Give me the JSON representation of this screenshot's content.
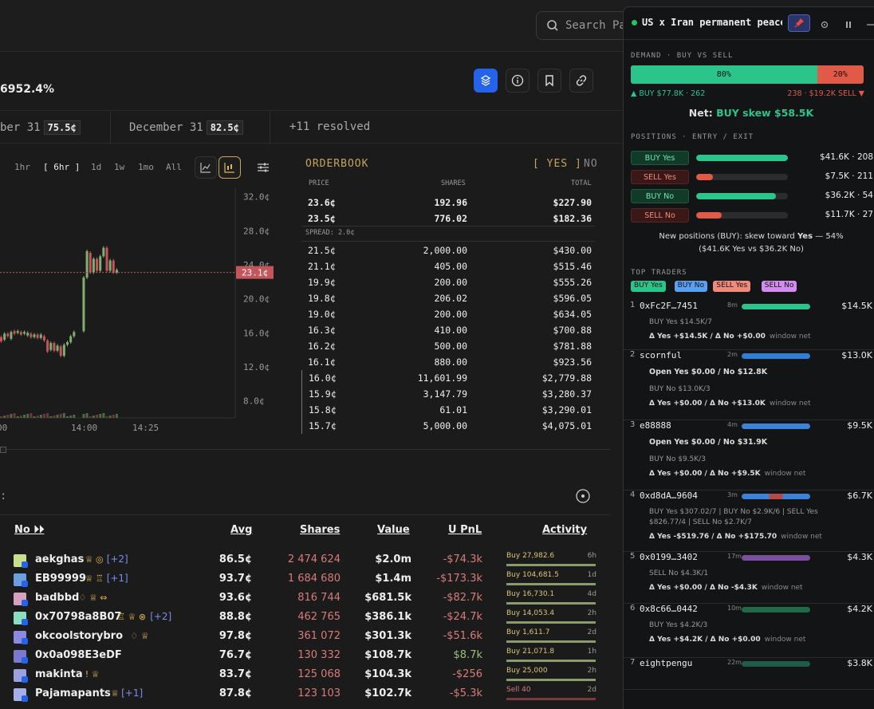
{
  "search": {
    "placeholder": "Search Pa"
  },
  "market": {
    "percent_change": "6952.4%"
  },
  "dates": [
    {
      "label": "ber 31",
      "price": "75.5¢"
    },
    {
      "label": "December 31",
      "price": "82.5¢"
    },
    {
      "label": "+11 resolved",
      "price": ""
    }
  ],
  "timeframes": [
    "1hr",
    "[ 6hr ]",
    "1d",
    "1w",
    "1mo",
    "All"
  ],
  "chart": {
    "y_ticks": [
      "32.0¢",
      "28.0¢",
      "24.0¢",
      "20.0¢",
      "16.0¢",
      "12.0¢",
      "8.0¢"
    ],
    "x_ticks": [
      "00",
      "14:00",
      "14:25"
    ],
    "current_price": "23.1¢"
  },
  "chart_data": {
    "type": "bar",
    "title": "",
    "xlabel": "",
    "ylabel": "",
    "ylim": [
      6,
      33
    ],
    "categories": [
      "00",
      "14:00",
      "14:25"
    ],
    "series": [
      {
        "name": "",
        "values": [
          15.5,
          15.2,
          23.1
        ]
      }
    ],
    "current": 23.1
  },
  "orderbook": {
    "title": "ORDERBOOK",
    "yes_label": "[ YES ]",
    "no_label": "NO",
    "cols": [
      "PRICE",
      "SHARES",
      "TOTAL"
    ],
    "spread": "SPREAD: 2.0¢",
    "asks": [
      [
        "23.6¢",
        "192.96",
        "$227.90"
      ],
      [
        "23.5¢",
        "776.02",
        "$182.36"
      ]
    ],
    "bids": [
      [
        "21.5¢",
        "2,000.00",
        "$430.00"
      ],
      [
        "21.1¢",
        "405.00",
        "$515.46"
      ],
      [
        "19.9¢",
        "200.00",
        "$555.26"
      ],
      [
        "19.8¢",
        "206.02",
        "$596.05"
      ],
      [
        "19.0¢",
        "200.00",
        "$634.05"
      ],
      [
        "16.3¢",
        "410.00",
        "$700.88"
      ],
      [
        "16.2¢",
        "500.00",
        "$781.88"
      ],
      [
        "16.1¢",
        "880.00",
        "$923.56"
      ],
      [
        "16.0¢",
        "11,601.99",
        "$2,779.88"
      ],
      [
        "15.9¢",
        "3,147.79",
        "$3,280.37"
      ],
      [
        "15.8¢",
        "61.01",
        "$3,290.01"
      ],
      [
        "15.7¢",
        "5,000.00",
        "$4,075.01"
      ]
    ]
  },
  "holders": {
    "cols": {
      "name": "No ⏵⏵",
      "avg": "Avg",
      "shares": "Shares",
      "value": "Value",
      "upnl": "U PnL",
      "activity": "Activity"
    },
    "rows": [
      {
        "name": "aekghas",
        "badges": "♕ ◎",
        "extra": "[+2]",
        "avg": "86.5¢",
        "shares": "2 474 624",
        "value": "$2.0m",
        "upnl": "-$74.3k",
        "act": "Buy 27,982.6",
        "age": "6h",
        "pos": false
      },
      {
        "name": "EB99999",
        "badges": "♕ ♖",
        "extra": "[+1]",
        "avg": "93.7¢",
        "shares": "1 684 680",
        "value": "$1.4m",
        "upnl": "-$173.3k",
        "act": "Buy 104,681.5",
        "age": "1d",
        "pos": false
      },
      {
        "name": "badbbd",
        "badges": "♢ ♕ ⇔",
        "extra": "",
        "avg": "93.6¢",
        "shares": "816 744",
        "value": "$681.5k",
        "upnl": "-$82.7k",
        "act": "Buy 16,730.1",
        "age": "4d",
        "pos": false
      },
      {
        "name": "0x70798a8B07",
        "badges": "♖ ♕ ⊗",
        "extra": "[+2]",
        "avg": "88.8¢",
        "shares": "462 765",
        "value": "$386.1k",
        "upnl": "-$24.7k",
        "act": "Buy 14,053.4",
        "age": "2h",
        "pos": false
      },
      {
        "name": "okcoolstorybro",
        "badges": "♢ ♕",
        "extra": "",
        "avg": "97.8¢",
        "shares": "361 072",
        "value": "$301.3k",
        "upnl": "-$51.6k",
        "act": "Buy 1,611.7",
        "age": "2d",
        "pos": false
      },
      {
        "name": "0x0a098E3eDF",
        "badges": "",
        "extra": "",
        "avg": "76.7¢",
        "shares": "130 332",
        "value": "$108.7k",
        "upnl": "$8.7k",
        "act": "Buy 21,071.8",
        "age": "1h",
        "pos": true
      },
      {
        "name": "makinta",
        "badges": "! ♕",
        "extra": "",
        "avg": "83.7¢",
        "shares": "125 068",
        "value": "$104.3k",
        "upnl": "-$256",
        "act": "Buy 25,000",
        "age": "2h",
        "pos": false
      },
      {
        "name": "Pajamapants",
        "badges": "♕",
        "extra": "[+1]",
        "avg": "87.8¢",
        "shares": "123 103",
        "value": "$102.7k",
        "upnl": "-$5.3k",
        "act": "Sell 40",
        "age": "2d",
        "pos": false
      }
    ]
  },
  "panel": {
    "title": "US x Iran permanent peace…",
    "demand_title": "DEMAND · BUY VS SELL",
    "buy_pct": "80%",
    "sell_pct": "20%",
    "buy_frac": 0.8,
    "buy_info": "▲ BUY $77.8K · 262",
    "sell_info": "238 · $19.2K SELL ▼",
    "net_label": "Net:",
    "net_value": "BUY skew $58.5K",
    "positions_title": "POSITIONS · ENTRY / EXIT",
    "positions": [
      {
        "label": "BUY Yes",
        "value": "$41.6K · 208",
        "frac": 1.0,
        "kind": "buy"
      },
      {
        "label": "SELL Yes",
        "value": "$7.5K · 211",
        "frac": 0.18,
        "kind": "sell"
      },
      {
        "label": "BUY No",
        "value": "$36.2K · 54",
        "frac": 0.87,
        "kind": "buy"
      },
      {
        "label": "SELL No",
        "value": "$11.7K · 27",
        "frac": 0.28,
        "kind": "sell"
      }
    ],
    "new_pos_prefix": "New positions (BUY): skew toward",
    "new_pos_side": "Yes",
    "new_pos_suffix": "— 54%",
    "new_pos_line2": "($41.6K Yes vs $36.2K No)",
    "traders_title": "TOP TRADERS",
    "chips": [
      "BUY Yes",
      "BUY No",
      "SELL Yes",
      "SELL No"
    ],
    "traders": [
      {
        "rank": "1",
        "name": "0xFc2F…7451",
        "age": "8m",
        "value": "$14.5K",
        "open": "",
        "l1": "BUY Yes $14.5K/7",
        "l2": "",
        "delta": "Δ Yes +$14.5K / Δ No +$0.00",
        "dtail": "window net"
      },
      {
        "rank": "2",
        "name": "scornful",
        "age": "2m",
        "value": "$13.0K",
        "open": "Open Yes $0.00 / No $12.8K",
        "l1": "BUY No $13.0K/3",
        "l2": "",
        "delta": "Δ Yes +$0.00 / Δ No +$13.0K",
        "dtail": "window net"
      },
      {
        "rank": "3",
        "name": "e88888",
        "age": "4m",
        "value": "$9.5K",
        "open": "Open Yes $0.00 / No $31.9K",
        "l1": "BUY No $9.5K/3",
        "l2": "",
        "delta": "Δ Yes +$0.00 / Δ No +$9.5K",
        "dtail": "window net"
      },
      {
        "rank": "4",
        "name": "0xd8dA…9604",
        "age": "3m",
        "value": "$6.7K",
        "open": "",
        "l1": "BUY Yes $307.02/7 | BUY No $2.9K/6 | SELL Yes",
        "l2": "$826.77/4 | SELL No $2.7K/7",
        "delta": "Δ Yes -$519.76 / Δ No +$175.70",
        "dtail": "window net"
      },
      {
        "rank": "5",
        "name": "0x0199…3402",
        "age": "17m",
        "value": "$4.3K",
        "open": "",
        "l1": "SELL No $4.3K/1",
        "l2": "",
        "delta": "Δ Yes +$0.00 / Δ No -$4.3K",
        "dtail": "window net"
      },
      {
        "rank": "6",
        "name": "0x8c66…0442",
        "age": "10m",
        "value": "$4.2K",
        "open": "",
        "l1": "BUY Yes $4.2K/3",
        "l2": "",
        "delta": "Δ Yes +$4.2K / Δ No +$0.00",
        "dtail": "window net"
      },
      {
        "rank": "7",
        "name": "eightpengu",
        "age": "22m",
        "value": "$3.8K",
        "open": "",
        "l1": "",
        "l2": "",
        "delta": "",
        "dtail": ""
      }
    ]
  }
}
